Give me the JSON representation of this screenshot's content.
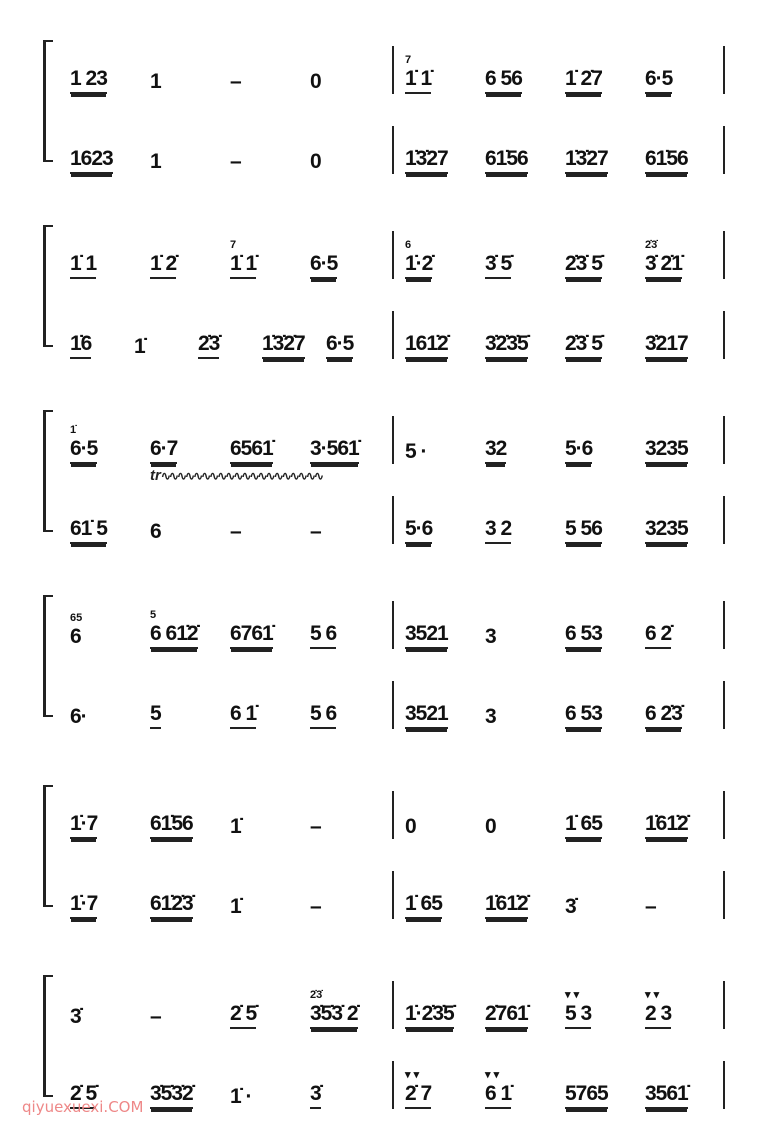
{
  "score": {
    "systems": [
      {
        "staves": [
          {
            "measures": [
              [
                {
                  "t": "1 23",
                  "u": 2
                },
                {
                  "t": "1",
                  "u": 0
                },
                {
                  "t": "–",
                  "u": 0
                },
                {
                  "t": "0",
                  "u": 0
                }
              ],
              [
                {
                  "g": "7",
                  "t": "1̇ 1̇",
                  "u": 1
                },
                {
                  "t": "6 56",
                  "u": 2
                },
                {
                  "t": "1̇ 2̇7",
                  "u": 2
                },
                {
                  "t": "6·5",
                  "u": 2
                }
              ]
            ]
          },
          {
            "measures": [
              [
                {
                  "t": "1623",
                  "u": 2
                },
                {
                  "t": "1",
                  "u": 0
                },
                {
                  "t": "–",
                  "u": 0
                },
                {
                  "t": "0",
                  "u": 0
                }
              ],
              [
                {
                  "t": "1̇3̇27",
                  "u": 2
                },
                {
                  "t": "61̇56",
                  "u": 2
                },
                {
                  "t": "1̇3̇27",
                  "u": 2
                },
                {
                  "t": "61̇56",
                  "u": 2
                }
              ]
            ]
          }
        ]
      },
      {
        "staves": [
          {
            "measures": [
              [
                {
                  "t": "1̇ 1",
                  "u": 1
                },
                {
                  "t": "1̇ 2̇",
                  "u": 1
                },
                {
                  "g": "7",
                  "t": "1̇ 1̇",
                  "u": 1
                },
                {
                  "t": "6·5",
                  "u": 2
                }
              ],
              [
                {
                  "g": "6",
                  "t": "1̇·2̇",
                  "u": 2
                },
                {
                  "t": "3̇ 5̇",
                  "u": 1
                },
                {
                  "t": "2̇3̇ 5̇",
                  "u": 2
                },
                {
                  "g": "2̇3̇",
                  "t": "3̇ 2̇1̇",
                  "u": 2
                }
              ]
            ]
          },
          {
            "measures": [
              [
                {
                  "t": "1̇6",
                  "u": 1
                },
                {
                  "t": "1̇",
                  "u": 0
                },
                {
                  "t": "2̇3̇",
                  "u": 1
                },
                {
                  "t": "1̇3̇2̇7",
                  "u": 2
                },
                {
                  "t": "6·5",
                  "u": 2
                }
              ],
              [
                {
                  "t": "161̇2̇",
                  "u": 2
                },
                {
                  "t": "3̇2̇3̇5̇",
                  "u": 2
                },
                {
                  "t": "2̇3̇ 5̇",
                  "u": 2
                },
                {
                  "t": "3̇217",
                  "u": 2
                }
              ]
            ]
          }
        ]
      },
      {
        "staves": [
          {
            "measures": [
              [
                {
                  "g": "1̇",
                  "t": "6·5",
                  "u": 2
                },
                {
                  "t": "6·7",
                  "u": 2
                },
                {
                  "t": "6561̇",
                  "u": 2
                },
                {
                  "t": "3·561̇",
                  "u": 2
                }
              ],
              [
                {
                  "t": "5 ·",
                  "u": 0
                },
                {
                  "t": "32",
                  "u": 2
                },
                {
                  "t": "5·6",
                  "u": 2
                },
                {
                  "t": "3235",
                  "u": 2
                }
              ]
            ]
          },
          {
            "measures": [
              [
                {
                  "t": "61̇ 5",
                  "u": 2
                },
                {
                  "t": "6",
                  "u": 0
                },
                {
                  "t": "–",
                  "u": 0
                },
                {
                  "t": "–",
                  "u": 0
                }
              ],
              [
                {
                  "t": "5·6",
                  "u": 2
                },
                {
                  "t": "3 2",
                  "u": 1
                },
                {
                  "t": "5 56",
                  "u": 2
                },
                {
                  "t": "3235",
                  "u": 2
                }
              ]
            ]
          }
        ]
      },
      {
        "staves": [
          {
            "measures": [
              [
                {
                  "g": "65",
                  "t": "6",
                  "u": 0
                },
                {
                  "g": "5",
                  "t": "6 61̇2̇",
                  "u": 2
                },
                {
                  "t": "6761̇",
                  "u": 2
                },
                {
                  "t": "5 6",
                  "u": 1
                }
              ],
              [
                {
                  "t": "3521",
                  "u": 2
                },
                {
                  "t": "3",
                  "u": 0
                },
                {
                  "t": "6 53",
                  "u": 2
                },
                {
                  "t": "6 2̇",
                  "u": 1
                }
              ]
            ]
          },
          {
            "measures": [
              [
                {
                  "t": "6·",
                  "u": 0
                },
                {
                  "t": "5",
                  "u": 1
                },
                {
                  "t": "6 1̇",
                  "u": 1
                },
                {
                  "t": "5 6",
                  "u": 1
                }
              ],
              [
                {
                  "t": "3521",
                  "u": 2
                },
                {
                  "t": "3",
                  "u": 0
                },
                {
                  "t": "6 53",
                  "u": 2
                },
                {
                  "t": "6 2̇3̇",
                  "u": 2
                }
              ]
            ]
          }
        ]
      },
      {
        "staves": [
          {
            "measures": [
              [
                {
                  "t": "1̇·7",
                  "u": 2
                },
                {
                  "t": "61̇56",
                  "u": 2
                },
                {
                  "t": "1̇",
                  "u": 0
                },
                {
                  "t": "–",
                  "u": 0
                }
              ],
              [
                {
                  "t": "0",
                  "u": 0
                },
                {
                  "t": "0",
                  "u": 0
                },
                {
                  "t": "1̇ 65",
                  "u": 2
                },
                {
                  "t": "1̇61̇2̇",
                  "u": 2
                }
              ]
            ]
          },
          {
            "measures": [
              [
                {
                  "t": "1̇·7",
                  "u": 2
                },
                {
                  "t": "61̇2̇3̇",
                  "u": 2
                },
                {
                  "t": "1̇",
                  "u": 0
                },
                {
                  "t": "–",
                  "u": 0
                }
              ],
              [
                {
                  "t": "1̇ 65",
                  "u": 2
                },
                {
                  "t": "1̇61̇2̇",
                  "u": 2
                },
                {
                  "t": "3̇",
                  "u": 0
                },
                {
                  "t": "–",
                  "u": 0
                }
              ]
            ]
          }
        ]
      },
      {
        "staves": [
          {
            "measures": [
              [
                {
                  "t": "3̇",
                  "u": 0
                },
                {
                  "t": "–",
                  "u": 0
                },
                {
                  "t": "2̇ 5̇",
                  "u": 1
                },
                {
                  "g": "2̇3̇",
                  "t": "3̇5̇3̇ 2̇",
                  "u": 2
                }
              ],
              [
                {
                  "t": "1̇·2̇3̇5̇",
                  "u": 2
                },
                {
                  "t": "2̇761̇",
                  "u": 2
                },
                {
                  "g": "▾ ▾",
                  "t": "5 3",
                  "u": 1
                },
                {
                  "g": "▾ ▾",
                  "t": "2 3",
                  "u": 1
                }
              ]
            ]
          },
          {
            "measures": [
              [
                {
                  "t": "2̇ 5̇",
                  "u": 1
                },
                {
                  "t": "3̇5̇3̇2̇",
                  "u": 2
                },
                {
                  "t": "1̇ ·",
                  "u": 0
                },
                {
                  "t": "3̇",
                  "u": 1
                }
              ],
              [
                {
                  "g": "▾ ▾",
                  "t": "2̇ 7",
                  "u": 1
                },
                {
                  "g": "▾ ▾",
                  "t": "6 1̇",
                  "u": 1
                },
                {
                  "t": "5765",
                  "u": 2
                },
                {
                  "t": "3561̇",
                  "u": 2
                }
              ]
            ]
          }
        ]
      }
    ],
    "trill_mark": "tr",
    "watermark": "qiyuexuexi.COM"
  }
}
